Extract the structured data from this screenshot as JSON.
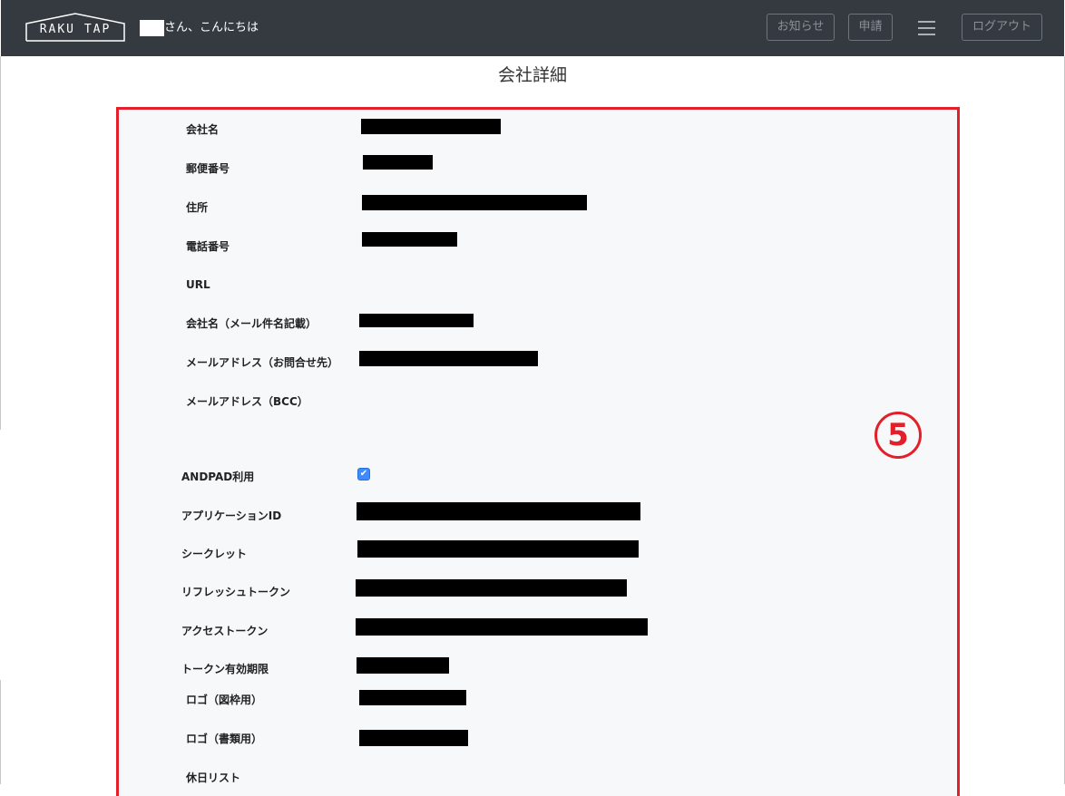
{
  "header": {
    "logo_text": "RAKU TAP",
    "greeting": "さん、こんにちは",
    "news_button": "お知らせ",
    "apply_button": "申請",
    "logout_button": "ログアウト"
  },
  "page": {
    "title": "会社詳細"
  },
  "annotation": {
    "marker": "5",
    "color": "#e3202a"
  },
  "form": {
    "labels": {
      "company_name": "会社名",
      "postal_code": "郵便番号",
      "address": "住所",
      "phone": "電話番号",
      "url": "URL",
      "company_name_mail": "会社名（メール件名記載）",
      "mail_contact": "メールアドレス（お問合せ先）",
      "mail_bcc": "メールアドレス（BCC）",
      "andpad": "ANDPAD利用",
      "app_id": "アプリケーションID",
      "secret": "シークレット",
      "refresh_token": "リフレッシュトークン",
      "access_token": "アクセストークン",
      "token_expiry": "トークン有効期限",
      "logo_drawing": "ロゴ（図枠用）",
      "logo_document": "ロゴ（書類用）",
      "holiday_list": "休日リスト"
    },
    "andpad_checked": true
  }
}
